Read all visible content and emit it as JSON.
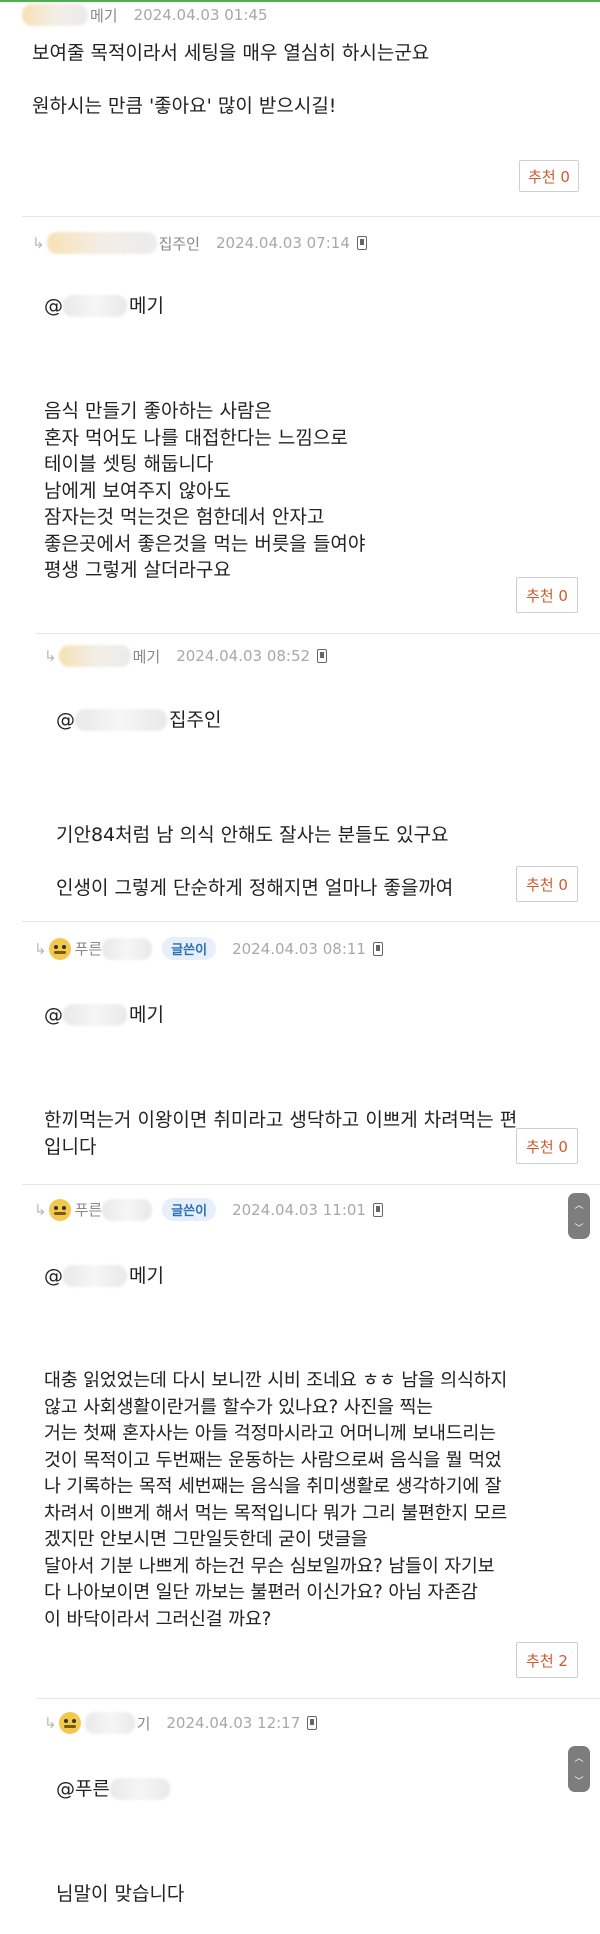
{
  "comments": [
    {
      "nickname_suffix": "메기",
      "date": "2024.04.03 01:45",
      "body": "보여줄 목적이라서 세팅을 매우 열심히 하시는군요\n\n원하시는 만큼 '좋아요' 많이 받으시길!",
      "recommend_label": "추천 0"
    },
    {
      "reply_arrow": "↳",
      "nickname_suffix": "집주인",
      "date": "2024.04.03 07:14",
      "mention_prefix": "@",
      "mention_suffix": "메기",
      "body": "음식 만들기 좋아하는 사람은\n혼자 먹어도 나를 대접한다는 느낌으로\n테이블 셋팅 해둡니다\n남에게 보여주지 않아도\n잠자는것 먹는것은 험한데서 안자고\n좋은곳에서 좋은것을 먹는 버릇을 들여야\n평생 그렇게 살더라구요",
      "recommend_label": "추천 0"
    },
    {
      "reply_arrow": "↳",
      "nickname_suffix": "메기",
      "date": "2024.04.03 08:52",
      "mention_prefix": "@",
      "mention_suffix": "집주인",
      "body": "기안84처럼 남 의식 안해도 잘사는 분들도 있구요\n\n인생이 그렇게 단순하게 정해지면 얼마나 좋을까여",
      "recommend_label": "추천 0"
    },
    {
      "reply_arrow": "↳",
      "nickname_prefix": "푸른",
      "author_badge": "글쓴이",
      "date": "2024.04.03 08:11",
      "mention_prefix": "@",
      "mention_suffix": "메기",
      "body": "한끼먹는거 이왕이면 취미라고 생닥하고 이쁘게 차려먹는 편\n입니다",
      "recommend_label": "추천 0"
    },
    {
      "reply_arrow": "↳",
      "nickname_prefix": "푸른",
      "author_badge": "글쓴이",
      "date": "2024.04.03 11:01",
      "mention_prefix": "@",
      "mention_suffix": "메기",
      "body": "대충 읽었었는데 다시 보니깐 시비 조네요 ㅎㅎ 남을 의식하지\n않고 사회생활이란거를 할수가 있나요? 사진을 찍는\n거는 첫째 혼자사는 아들 걱정마시라고 어머니께 보내드리는\n것이 목적이고 두번째는 운동하는 사람으로써 음식을 뭘 먹었\n나 기록하는 목적 세번째는 음식을 취미생활로 생각하기에 잘\n차려서 이쁘게 해서 먹는 목적입니다 뭐가 그리 불편한지 모르\n겠지만 안보시면 그만일듯한데 굳이 댓글을\n달아서 기분 나쁘게 하는건 무슨 심보일까요? 남들이 자기보\n다 나아보이면 일단 까보는 불편러 이신가요? 아님 자존감\n이 바닥이라서 그러신걸 까요?",
      "recommend_label": "추천 2"
    },
    {
      "reply_arrow": "↳",
      "nickname_suffix": "기",
      "date": "2024.04.03 12:17",
      "mention_prefix": "@푸른",
      "body": "님말이 맞습니다"
    }
  ],
  "icons": {
    "phone": "mobile-phone-icon",
    "scroll_up": "chevron-up-icon",
    "scroll_down": "chevron-down-icon",
    "avatar_emoji": "grinning-face-icon"
  },
  "scroll_glyphs": {
    "up": "︿",
    "down": "﹀"
  },
  "colors": {
    "top_rule": "#4caf50",
    "recommend_text": "#d05a2d",
    "author_badge_text": "#2b6fb5",
    "author_badge_bg": "#e7f0fa"
  }
}
